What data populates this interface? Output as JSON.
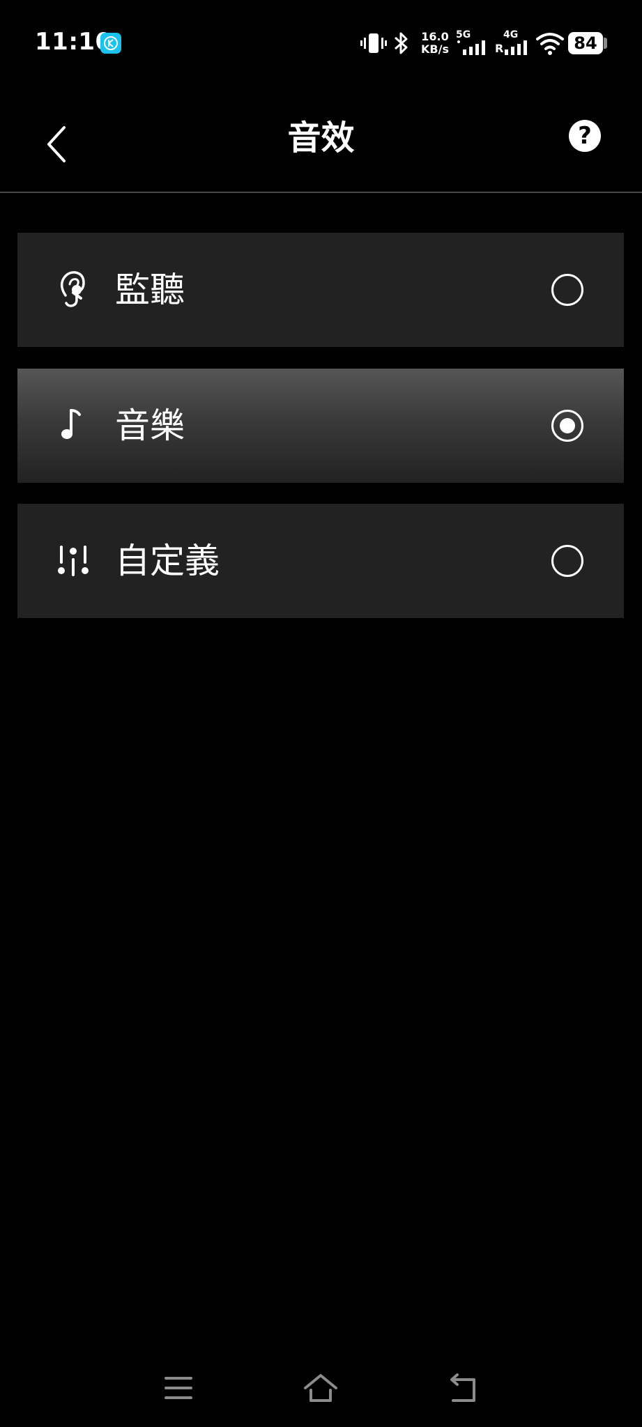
{
  "status_bar": {
    "time": "11:10",
    "net_speed_value": "16.0",
    "net_speed_unit": "KB/s",
    "network_1": "5G",
    "network_2": "4G",
    "network_2_roaming": "R",
    "battery": "84",
    "badge_color": "#19c3ee"
  },
  "header": {
    "title": "音效",
    "back_icon": "chevron-left-icon",
    "help_icon": "question-mark-icon",
    "help_glyph": "?"
  },
  "options": [
    {
      "label": "監聽",
      "icon": "ear-icon",
      "selected": false
    },
    {
      "label": "音樂",
      "icon": "music-note-icon",
      "selected": true
    },
    {
      "label": "自定義",
      "icon": "equalizer-icon",
      "selected": false
    }
  ],
  "nav_bar": {
    "menu_icon": "menu-icon",
    "home_icon": "home-icon",
    "back_icon": "back-arrow-icon"
  },
  "colors": {
    "background": "#000000",
    "card": "#222222",
    "card_selected_top": "#565656",
    "text": "#ffffff"
  }
}
